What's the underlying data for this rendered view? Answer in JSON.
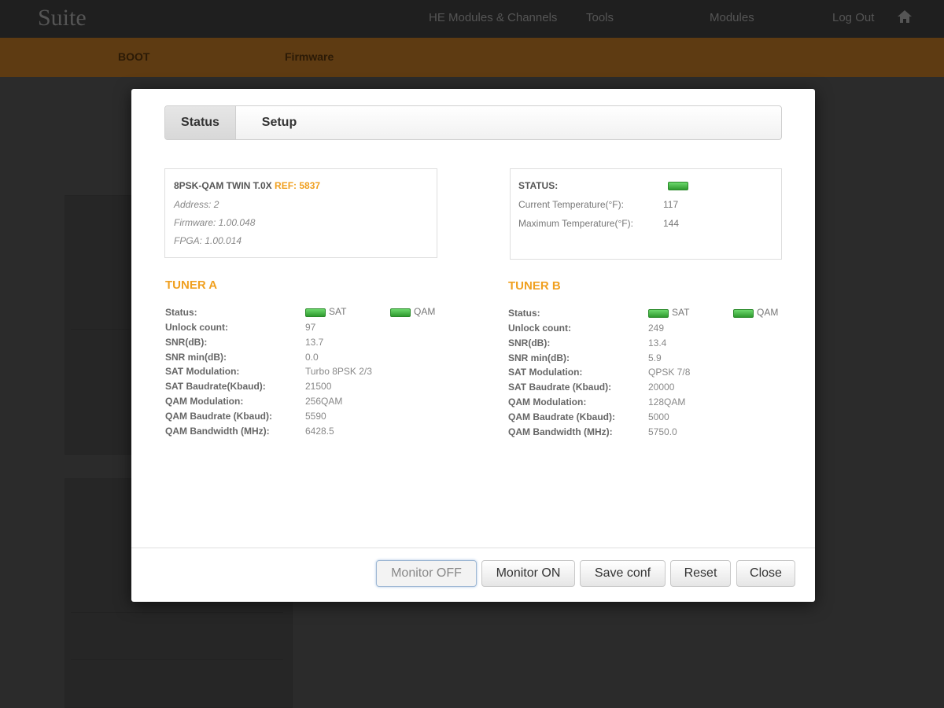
{
  "background": {
    "logo": "Suite",
    "topnav": [
      "HE Modules & Channels",
      "Tools",
      "Modules",
      "Log Out"
    ],
    "menu": [
      "BOOT",
      "Firmware"
    ]
  },
  "modal": {
    "tabs": [
      {
        "label": "Status",
        "active": true
      },
      {
        "label": "Setup",
        "active": false
      }
    ],
    "device": {
      "model": "8PSK-QAM TWIN T.0X",
      "ref": "REF: 5837",
      "address": "Address: 2",
      "firmware": "Firmware: 1.00.048",
      "fpga": "FPGA: 1.00.014"
    },
    "status_box": {
      "status_label": "STATUS:",
      "status_color": "#3fae3f",
      "current_temp_label": "Current Temperature(°F):",
      "current_temp_value": "117",
      "max_temp_label": "Maximum Temperature(°F):",
      "max_temp_value": "144"
    },
    "tuner_a": {
      "title": "TUNER A",
      "sat_label": "SAT",
      "qam_label": "QAM",
      "rows": [
        {
          "label": "Status:",
          "value": ""
        },
        {
          "label": "Unlock count:",
          "value": "97"
        },
        {
          "label": "SNR(dB):",
          "value": "13.7"
        },
        {
          "label": "SNR min(dB):",
          "value": "0.0"
        },
        {
          "label": "SAT Modulation:",
          "value": "Turbo 8PSK 2/3"
        },
        {
          "label": "SAT Baudrate(Kbaud):",
          "value": "21500"
        },
        {
          "label": "QAM Modulation:",
          "value": "256QAM"
        },
        {
          "label": "QAM Baudrate (Kbaud):",
          "value": "5590"
        },
        {
          "label": "QAM Bandwidth (MHz):",
          "value": "6428.5"
        }
      ]
    },
    "tuner_b": {
      "title": "TUNER B",
      "sat_label": "SAT",
      "qam_label": "QAM",
      "rows": [
        {
          "label": "Status:",
          "value": ""
        },
        {
          "label": "Unlock count:",
          "value": "249"
        },
        {
          "label": "SNR(dB):",
          "value": "13.4"
        },
        {
          "label": "SNR min(dB):",
          "value": "5.9"
        },
        {
          "label": "SAT Modulation:",
          "value": "QPSK 7/8"
        },
        {
          "label": "SAT Baudrate (Kbaud):",
          "value": "20000"
        },
        {
          "label": "QAM Modulation:",
          "value": "128QAM"
        },
        {
          "label": "QAM Baudrate (Kbaud):",
          "value": "5000"
        },
        {
          "label": "QAM Bandwidth (MHz):",
          "value": "5750.0"
        }
      ]
    },
    "buttons": {
      "monitor_off": "Monitor OFF",
      "monitor_on": "Monitor ON",
      "save_conf": "Save conf",
      "reset": "Reset",
      "close": "Close"
    }
  }
}
